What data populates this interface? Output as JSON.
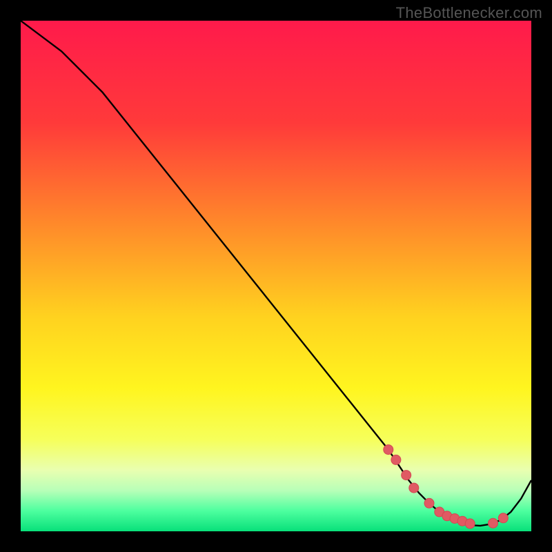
{
  "watermark": "TheBottlenecker.com",
  "colors": {
    "bg": "#000000",
    "curve": "#000000",
    "marker_fill": "#e05a63",
    "marker_stroke": "#d34852",
    "gradient_stops": [
      {
        "offset": 0.0,
        "color": "#ff1a4b"
      },
      {
        "offset": 0.2,
        "color": "#ff3a3a"
      },
      {
        "offset": 0.4,
        "color": "#ff8a2a"
      },
      {
        "offset": 0.58,
        "color": "#ffd21f"
      },
      {
        "offset": 0.72,
        "color": "#fff51f"
      },
      {
        "offset": 0.82,
        "color": "#f6ff5a"
      },
      {
        "offset": 0.88,
        "color": "#e9ffb0"
      },
      {
        "offset": 0.92,
        "color": "#b8ffb8"
      },
      {
        "offset": 0.96,
        "color": "#4dff9f"
      },
      {
        "offset": 1.0,
        "color": "#08e07a"
      }
    ]
  },
  "chart_data": {
    "type": "line",
    "title": "",
    "xlabel": "",
    "ylabel": "",
    "xlim": [
      0,
      100
    ],
    "ylim": [
      0,
      100
    ],
    "series": [
      {
        "name": "bottleneck-curve",
        "x": [
          0,
          4,
          8,
          12,
          16,
          20,
          24,
          28,
          32,
          36,
          40,
          44,
          48,
          52,
          56,
          60,
          64,
          68,
          72,
          74,
          76,
          78,
          80,
          82,
          84,
          86,
          88,
          90,
          92,
          94,
          96,
          98,
          100
        ],
        "y": [
          100,
          97,
          94,
          90,
          86,
          81,
          76,
          71,
          66,
          61,
          56,
          51,
          46,
          41,
          36,
          31,
          26,
          21,
          16,
          13,
          10,
          7.5,
          5.5,
          3.8,
          2.5,
          1.7,
          1.2,
          1.1,
          1.4,
          2.2,
          3.8,
          6.4,
          10
        ]
      }
    ],
    "markers": {
      "name": "highlighted-points",
      "x": [
        72,
        73.5,
        75.5,
        77,
        80,
        82,
        83.5,
        85,
        86.5,
        88,
        92.5,
        94.5
      ],
      "y": [
        16,
        14,
        11,
        8.5,
        5.5,
        3.8,
        3.0,
        2.5,
        2.0,
        1.5,
        1.6,
        2.6
      ]
    }
  }
}
